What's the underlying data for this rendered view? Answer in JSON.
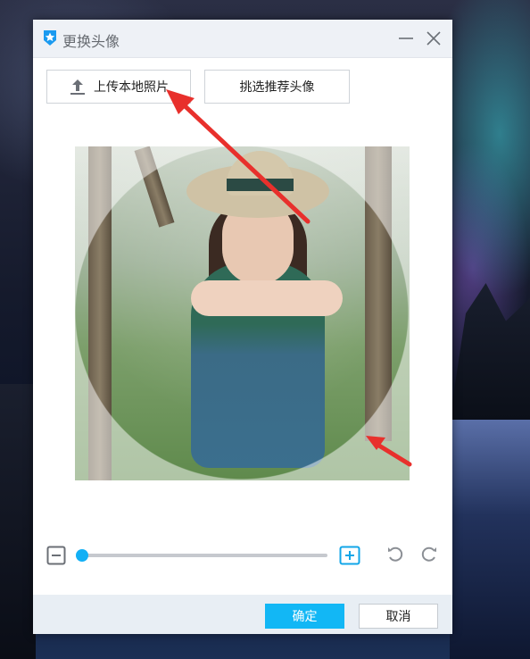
{
  "dialog": {
    "title": "更换头像",
    "upload_label": "上传本地照片",
    "recommend_label": "挑选推荐头像",
    "confirm_label": "确定",
    "cancel_label": "取消"
  },
  "zoom": {
    "level": 0
  },
  "icons": {
    "app": "qq-star-icon",
    "minimize": "minimize-icon",
    "close": "close-icon",
    "upload": "upload-icon",
    "zoom_out": "zoom-out-icon",
    "zoom_in": "zoom-in-icon",
    "rotate_left": "rotate-left-icon",
    "rotate_right": "rotate-right-icon"
  },
  "colors": {
    "accent": "#12b7f5",
    "annotation_arrow": "#e8302c"
  }
}
